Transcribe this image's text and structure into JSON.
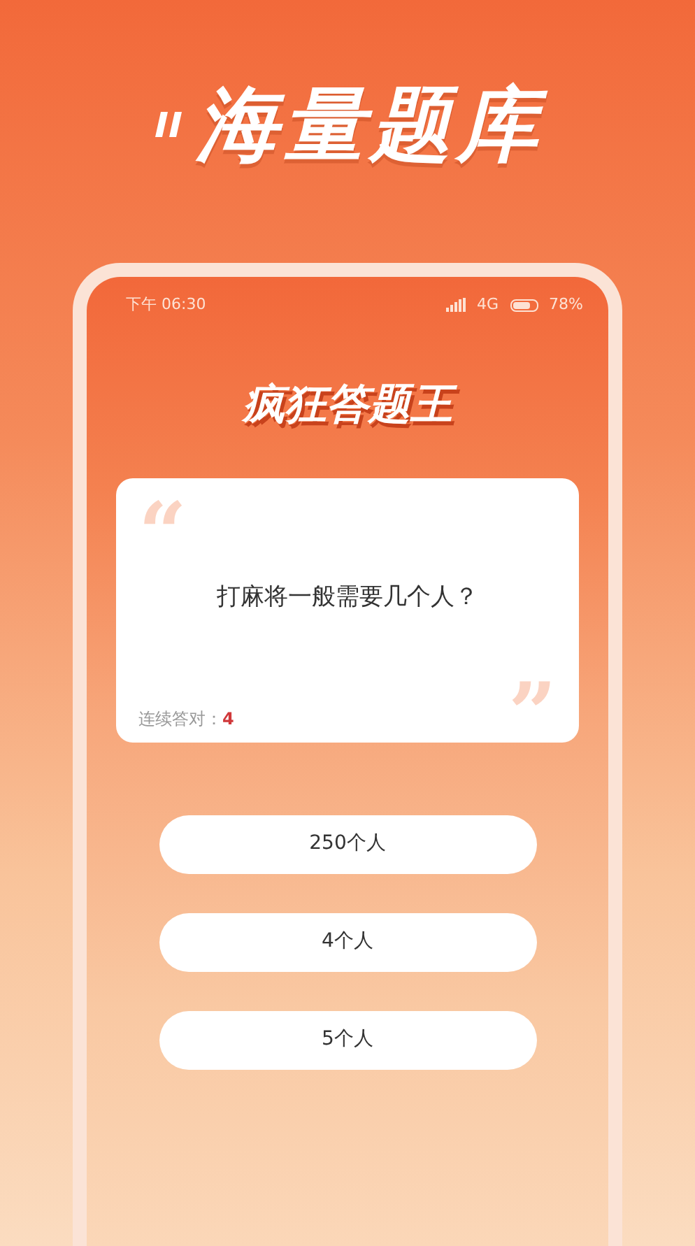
{
  "headline": "海量题库",
  "status_bar": {
    "time": "下午 06:30",
    "network": "4G",
    "battery": "78%",
    "battery_meter": {
      "level": 0.78
    }
  },
  "app_title": "疯狂答题王",
  "question_card": {
    "open_quote": "“",
    "question": "打麻将一般需要几个人？",
    "streak_label": "连续答对：",
    "streak_value": "4",
    "close_quote": "”"
  },
  "answers": [
    {
      "label": "250个人"
    },
    {
      "label": "4个人"
    },
    {
      "label": "5个人"
    }
  ]
}
